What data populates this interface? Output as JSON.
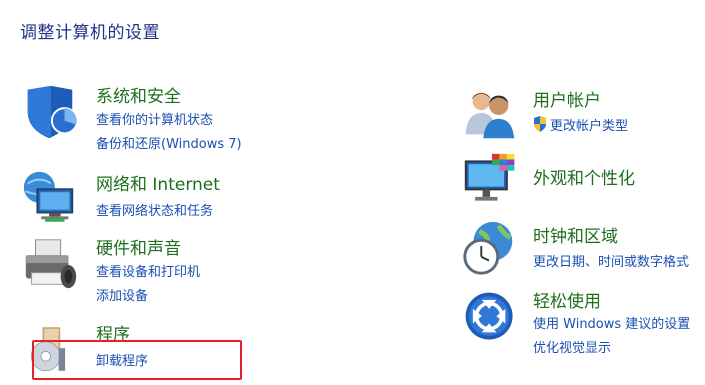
{
  "page_title": "调整计算机的设置",
  "highlight_color": "#e8202a",
  "left": [
    {
      "icon": "security-shield-icon",
      "title": "系统和安全",
      "links": [
        "查看你的计算机状态",
        "备份和还原(Windows 7)"
      ]
    },
    {
      "icon": "network-icon",
      "title": "网络和 Internet",
      "links": [
        "查看网络状态和任务"
      ]
    },
    {
      "icon": "printer-icon",
      "title": "硬件和声音",
      "links": [
        "查看设备和打印机",
        "添加设备"
      ]
    },
    {
      "icon": "programs-disc-icon",
      "title": "程序",
      "links": [
        "卸载程序"
      ]
    }
  ],
  "right": [
    {
      "icon": "users-icon",
      "title": "用户帐户",
      "links": [
        "更改帐户类型"
      ]
    },
    {
      "icon": "appearance-monitor-icon",
      "title": "外观和个性化",
      "links": []
    },
    {
      "icon": "clock-globe-icon",
      "title": "时钟和区域",
      "links": [
        "更改日期、时间或数字格式"
      ]
    },
    {
      "icon": "ease-of-access-icon",
      "title": "轻松使用",
      "links": [
        "使用 Windows 建议的设置",
        "优化视觉显示"
      ]
    }
  ]
}
